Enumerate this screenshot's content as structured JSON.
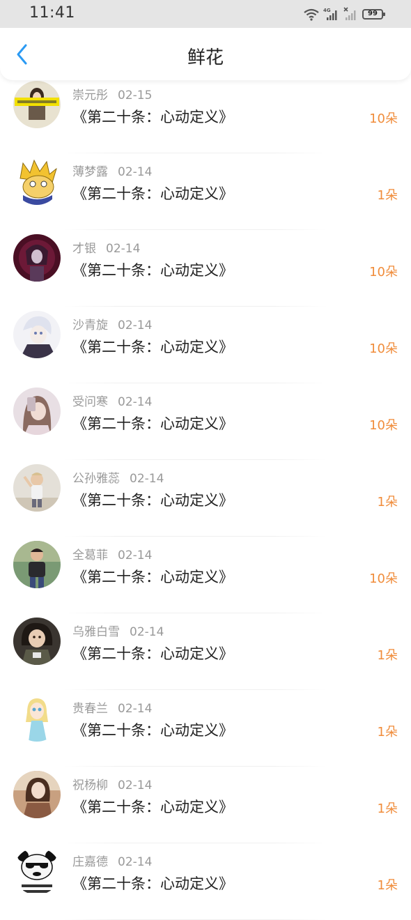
{
  "status_bar": {
    "time": "11:41",
    "battery": "99"
  },
  "header": {
    "title": "鲜花",
    "back_icon": "chevron-left-icon"
  },
  "colors": {
    "accent": "#2b9af3",
    "count": "#f08c3a",
    "name": "#999999",
    "title": "#222222"
  },
  "records": [
    {
      "name": "崇元彤",
      "date": "02-15",
      "movie": "《第二十条：心动定义》",
      "count": "10朵",
      "avatar": "#e8d9a8"
    },
    {
      "name": "薄梦露",
      "date": "02-14",
      "movie": "《第二十条：心动定义》",
      "count": "1朵",
      "avatar": "#f2c230"
    },
    {
      "name": "才银",
      "date": "02-14",
      "movie": "《第二十条：心动定义》",
      "count": "10朵",
      "avatar": "#5a1430"
    },
    {
      "name": "沙青旋",
      "date": "02-14",
      "movie": "《第二十条：心动定义》",
      "count": "10朵",
      "avatar": "#cfd4e6"
    },
    {
      "name": "受问寒",
      "date": "02-14",
      "movie": "《第二十条：心动定义》",
      "count": "10朵",
      "avatar": "#d9c4cc"
    },
    {
      "name": "公孙雅蕊",
      "date": "02-14",
      "movie": "《第二十条：心动定义》",
      "count": "1朵",
      "avatar": "#d8d4cc"
    },
    {
      "name": "全葛菲",
      "date": "02-14",
      "movie": "《第二十条：心动定义》",
      "count": "10朵",
      "avatar": "#6f8a6a"
    },
    {
      "name": "乌雅白雪",
      "date": "02-14",
      "movie": "《第二十条：心动定义》",
      "count": "1朵",
      "avatar": "#3a3530"
    },
    {
      "name": "贵春兰",
      "date": "02-14",
      "movie": "《第二十条：心动定义》",
      "count": "1朵",
      "avatar": "#bfe3ec"
    },
    {
      "name": "祝杨柳",
      "date": "02-14",
      "movie": "《第二十条：心动定义》",
      "count": "1朵",
      "avatar": "#b58a6a"
    },
    {
      "name": "庄嘉德",
      "date": "02-14",
      "movie": "《第二十条：心动定义》",
      "count": "1朵",
      "avatar": "#f4f4f4"
    }
  ]
}
